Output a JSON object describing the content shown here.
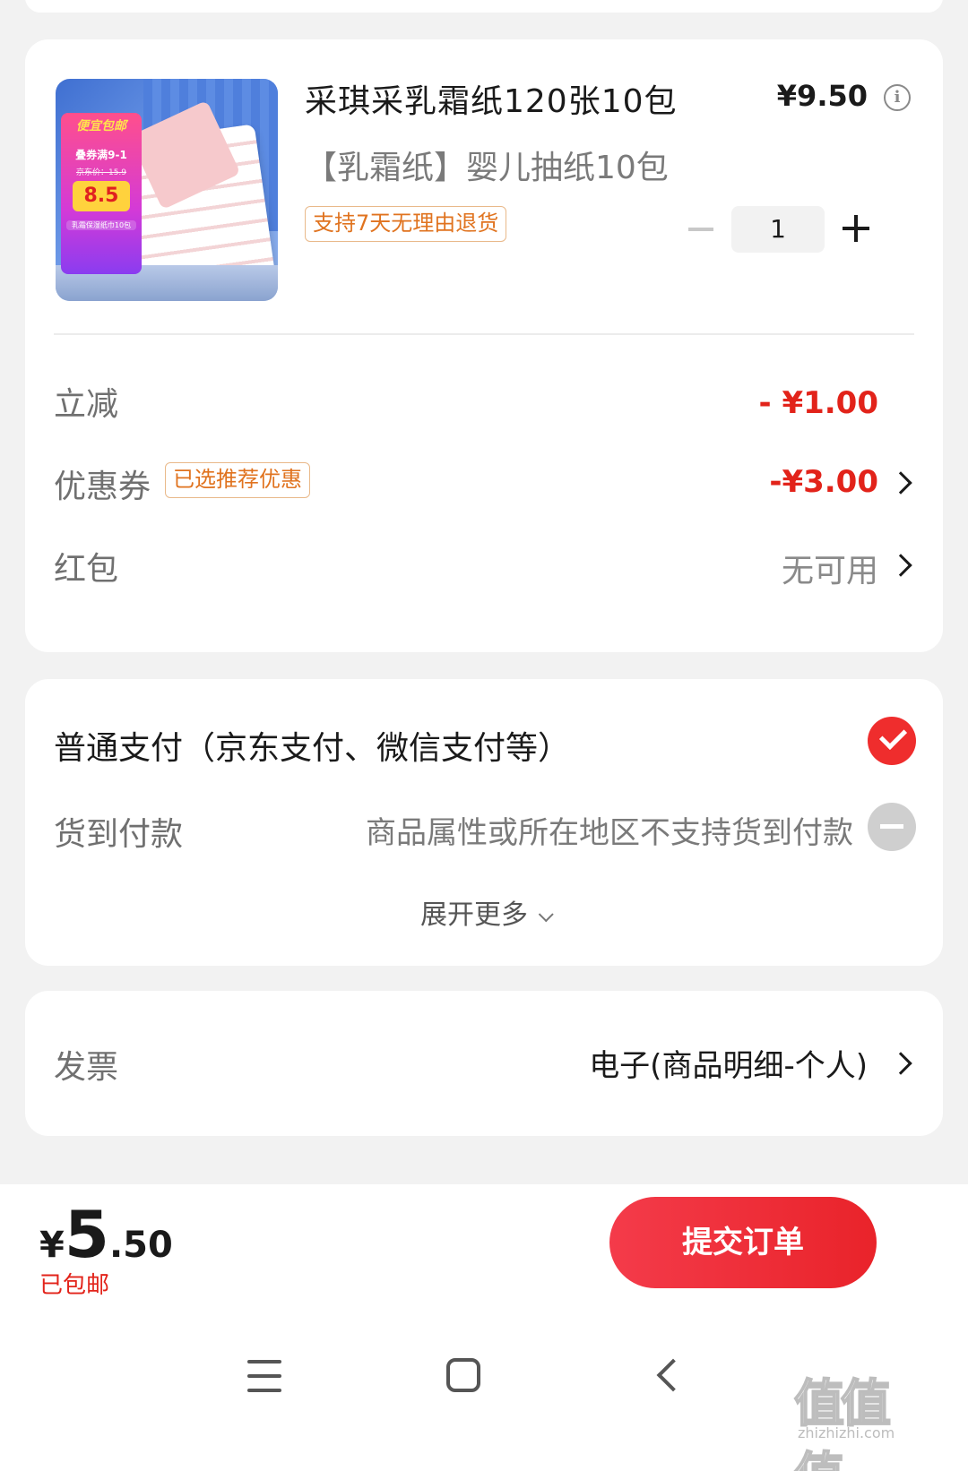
{
  "product": {
    "title": "采琪采乳霜纸120张10包",
    "subtitle": "【乳霜纸】婴儿抽纸10包",
    "return_tag": "支持7天无理由退货",
    "price": "¥9.50",
    "quantity": "1",
    "image_promo": {
      "line1": "便宜包邮",
      "line2": "叠券满9-1",
      "line3": "京东价：15.9",
      "price": "8.5",
      "line4": "乳霜保湿纸巾10包"
    }
  },
  "discounts": {
    "instant_label": "立减",
    "instant_value": "- ¥1.00",
    "coupon_label": "优惠券",
    "coupon_tag": "已选推荐优惠",
    "coupon_value": "-¥3.00",
    "redpacket_label": "红包",
    "redpacket_value": "无可用"
  },
  "payment": {
    "normal_label": "普通支付（京东支付、微信支付等）",
    "cod_label": "货到付款",
    "cod_note": "商品属性或所在地区不支持货到付款",
    "expand_label": "展开更多"
  },
  "invoice": {
    "label": "发票",
    "value": "电子(商品明细-个人)"
  },
  "checkout": {
    "currency": "¥",
    "total_int": "5",
    "total_dec": ".50",
    "shipping": "已包邮",
    "submit_label": "提交订单"
  },
  "icons": {
    "info": "info-icon",
    "check": "check-icon",
    "disabled": "minus-circle-icon",
    "chevron": "chevron-right-icon",
    "expand": "chevron-down-icon"
  },
  "colors": {
    "accent_red": "#e2231a",
    "tag_orange": "#e0731f"
  }
}
